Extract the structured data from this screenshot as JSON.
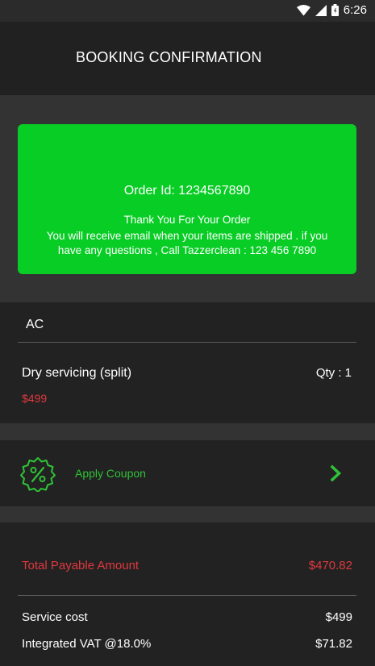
{
  "status_bar": {
    "time": "6:26",
    "icons": [
      "wifi-icon",
      "cell-signal-icon",
      "battery-icon"
    ]
  },
  "header": {
    "title": "BOOKING CONFIRMATION"
  },
  "confirmation": {
    "order_id": "Order Id: 1234567890",
    "thank_you": "Thank You For Your Order",
    "message": "You will receive email when your items are shipped . if you have any questions , Call Tazzerclean  : 123 456 7890",
    "card_color": "#08cd25"
  },
  "service": {
    "category": "AC",
    "item_name": "Dry servicing (split)",
    "item_qty": "Qty : 1",
    "item_price": "$499"
  },
  "coupon": {
    "icon": "discount-badge-icon",
    "label": "Apply Coupon",
    "chevron_icon": "chevron-right-icon",
    "accent_color": "#2fc236"
  },
  "summary": {
    "total_label": "Total Payable Amount",
    "total_value": "$470.82",
    "rows": [
      {
        "label": "Service cost",
        "value": "$499"
      },
      {
        "label": "Integrated VAT @18.0%",
        "value": "$71.82"
      }
    ],
    "highlight_color": "#e0383e"
  }
}
